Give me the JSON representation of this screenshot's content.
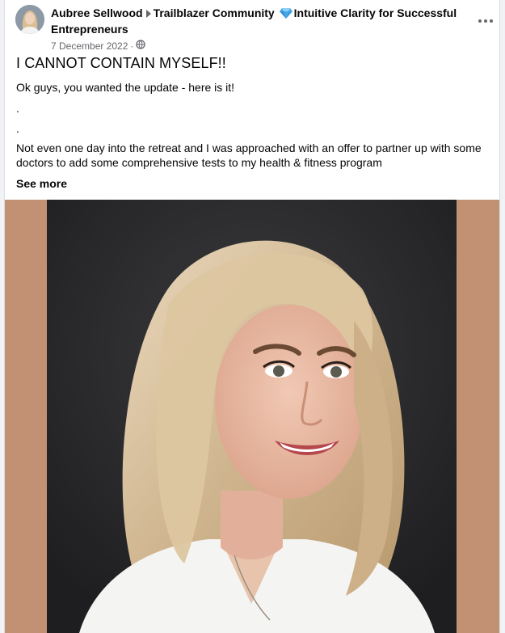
{
  "post": {
    "author": "Aubree Sellwood",
    "group": "Trailblazer Community",
    "topic": "Intuitive Clarity for Successful Entrepreneurs",
    "topic_icon": "gem-icon",
    "date": "7 December 2022",
    "separator": "·",
    "audience_icon": "globe-icon",
    "title": "I CANNOT CONTAIN MYSELF!!",
    "paragraphs": [
      "Ok guys, you wanted the update - here is it!",
      ".",
      ".",
      "Not even one day into the retreat and I was approached with an offer to partner up with some doctors to add some comprehensive tests to my health & fitness program"
    ],
    "see_more": "See more"
  },
  "colors": {
    "media_background": "#c29173",
    "photo_background": "#2a2a2c",
    "gem": "#4aa8e8",
    "text_primary": "#050505",
    "text_secondary": "#65676b"
  }
}
